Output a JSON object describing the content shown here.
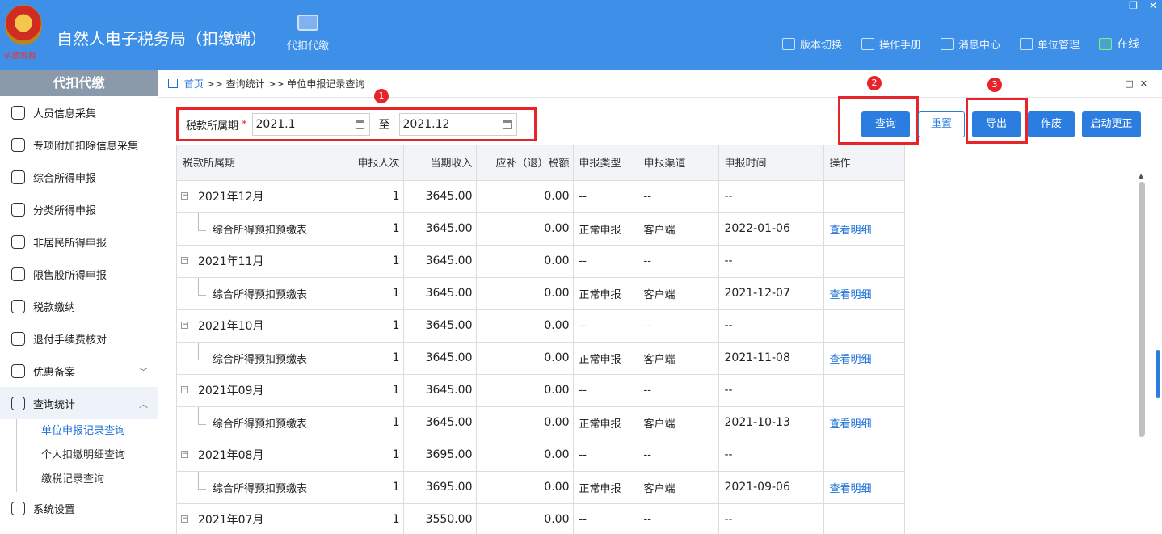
{
  "header": {
    "title": "自然人电子税务局（扣缴端）",
    "logo_text": "中國稅務",
    "module_label": "代扣代缴",
    "nav": [
      {
        "label": "版本切换",
        "icon": "document-icon"
      },
      {
        "label": "操作手册",
        "icon": "manual-icon"
      },
      {
        "label": "消息中心",
        "icon": "mail-icon"
      },
      {
        "label": "单位管理",
        "icon": "building-icon"
      }
    ],
    "online_label": "在线"
  },
  "sidebar": {
    "heading": "代扣代缴",
    "items": [
      {
        "label": "人员信息采集",
        "icon": "person-icon"
      },
      {
        "label": "专项附加扣除信息采集",
        "icon": "list-icon"
      },
      {
        "label": "综合所得申报",
        "icon": "layers-icon"
      },
      {
        "label": "分类所得申报",
        "icon": "pie-icon"
      },
      {
        "label": "非居民所得申报",
        "icon": "person-icon"
      },
      {
        "label": "限售股所得申报",
        "icon": "bar-chart-icon"
      },
      {
        "label": "税款缴纳",
        "icon": "folder-icon"
      },
      {
        "label": "退付手续费核对",
        "icon": "checklist-icon"
      },
      {
        "label": "优惠备案",
        "icon": "copy-icon"
      },
      {
        "label": "查询统计",
        "icon": "search-list-icon"
      }
    ],
    "submenu": [
      "单位申报记录查询",
      "个人扣缴明细查询",
      "缴税记录查询"
    ],
    "bottom_item": {
      "label": "系统设置",
      "icon": "gear-icon"
    }
  },
  "breadcrumb": {
    "home": "首页",
    "separator1": ">>",
    "level2": "查询统计",
    "separator2": ">>",
    "current": "单位申报记录查询"
  },
  "filter": {
    "label": "税款所属期",
    "required_mark": "*",
    "from": "2021.1",
    "to_label": "至",
    "to": "2021.12"
  },
  "badges": [
    "1",
    "2",
    "3"
  ],
  "buttons": {
    "query": "查询",
    "reset": "重置",
    "export": "导出",
    "void": "作废",
    "correct": "启动更正"
  },
  "table": {
    "columns": [
      "税款所属期",
      "申报人次",
      "当期收入",
      "应补（退）税额",
      "申报类型",
      "申报渠道",
      "申报时间",
      "操作"
    ],
    "rows": [
      {
        "period": "2021年12月",
        "count": "1",
        "income": "3645.00",
        "tax": "0.00",
        "type": "--",
        "channel": "--",
        "time": "--",
        "action": "",
        "child": false
      },
      {
        "period": "综合所得预扣预缴表",
        "count": "1",
        "income": "3645.00",
        "tax": "0.00",
        "type": "正常申报",
        "channel": "客户端",
        "time": "2022-01-06",
        "action": "查看明细",
        "child": true
      },
      {
        "period": "2021年11月",
        "count": "1",
        "income": "3645.00",
        "tax": "0.00",
        "type": "--",
        "channel": "--",
        "time": "--",
        "action": "",
        "child": false
      },
      {
        "period": "综合所得预扣预缴表",
        "count": "1",
        "income": "3645.00",
        "tax": "0.00",
        "type": "正常申报",
        "channel": "客户端",
        "time": "2021-12-07",
        "action": "查看明细",
        "child": true
      },
      {
        "period": "2021年10月",
        "count": "1",
        "income": "3645.00",
        "tax": "0.00",
        "type": "--",
        "channel": "--",
        "time": "--",
        "action": "",
        "child": false
      },
      {
        "period": "综合所得预扣预缴表",
        "count": "1",
        "income": "3645.00",
        "tax": "0.00",
        "type": "正常申报",
        "channel": "客户端",
        "time": "2021-11-08",
        "action": "查看明细",
        "child": true
      },
      {
        "period": "2021年09月",
        "count": "1",
        "income": "3645.00",
        "tax": "0.00",
        "type": "--",
        "channel": "--",
        "time": "--",
        "action": "",
        "child": false
      },
      {
        "period": "综合所得预扣预缴表",
        "count": "1",
        "income": "3645.00",
        "tax": "0.00",
        "type": "正常申报",
        "channel": "客户端",
        "time": "2021-10-13",
        "action": "查看明细",
        "child": true
      },
      {
        "period": "2021年08月",
        "count": "1",
        "income": "3695.00",
        "tax": "0.00",
        "type": "--",
        "channel": "--",
        "time": "--",
        "action": "",
        "child": false
      },
      {
        "period": "综合所得预扣预缴表",
        "count": "1",
        "income": "3695.00",
        "tax": "0.00",
        "type": "正常申报",
        "channel": "客户端",
        "time": "2021-09-06",
        "action": "查看明细",
        "child": true
      },
      {
        "period": "2021年07月",
        "count": "1",
        "income": "3550.00",
        "tax": "0.00",
        "type": "--",
        "channel": "--",
        "time": "--",
        "action": "",
        "child": false
      }
    ]
  },
  "colors": {
    "header_bg": "#3d8fe8",
    "accent": "#2b7de0",
    "highlight": "#e8242b",
    "link": "#1a6fd6"
  }
}
